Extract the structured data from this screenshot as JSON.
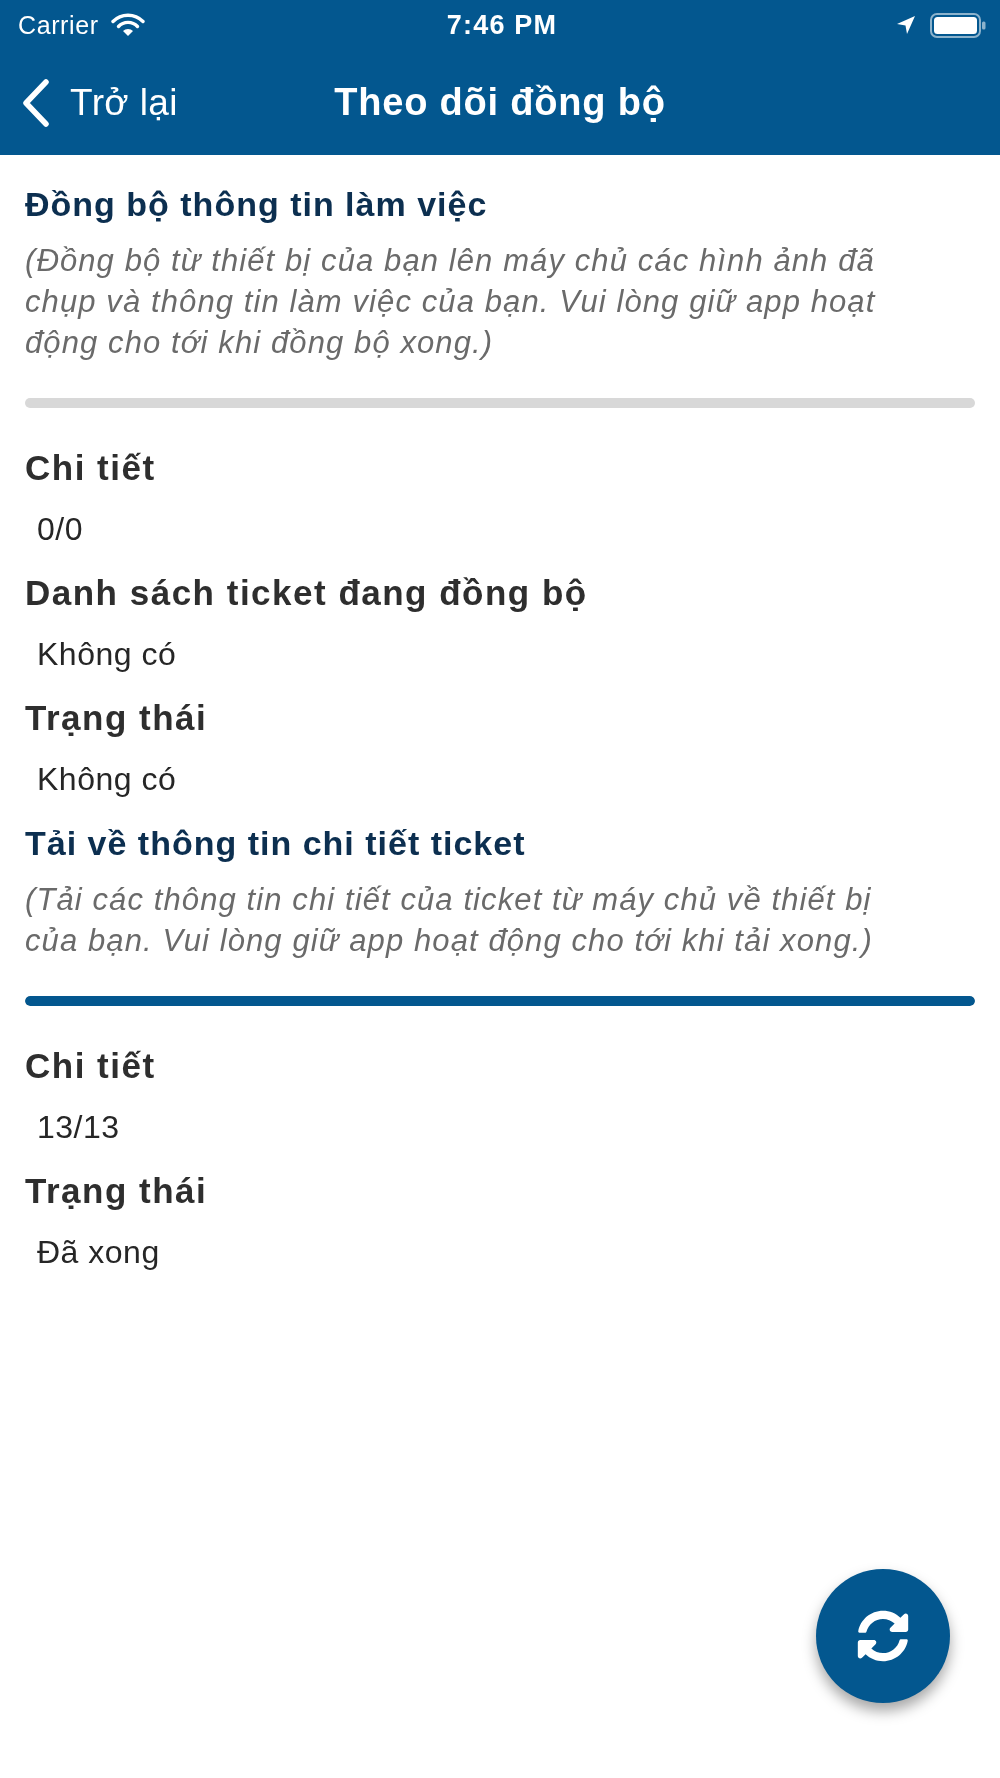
{
  "status_bar": {
    "carrier": "Carrier",
    "time": "7:46 PM"
  },
  "nav_bar": {
    "back": "Trở lại",
    "title": "Theo dõi đồng bộ"
  },
  "sections": [
    {
      "title": "Đồng bộ thông tin làm việc",
      "description": "(Đồng bộ từ thiết bị của bạn lên máy chủ các hình ảnh đã chụp và thông tin làm việc của bạn. Vui lòng giữ app hoạt động cho tới khi đồng bộ xong.)",
      "progress": {
        "level": 0
      },
      "fields": [
        {
          "label": "Chi tiết",
          "value": "0/0"
        },
        {
          "label": "Danh sách ticket đang đồng bộ",
          "value": "Không có"
        },
        {
          "label": "Trạng thái",
          "value": "Không có"
        }
      ]
    },
    {
      "title": "Tải về thông tin chi tiết ticket",
      "description": "(Tải các thông tin chi tiết của ticket từ máy chủ về thiết bị của bạn. Vui lòng giữ app hoạt động cho tới khi tải xong.)",
      "progress": {
        "level": 1
      },
      "fields": [
        {
          "label": "Chi tiết",
          "value": "13/13"
        },
        {
          "label": "Trạng thái",
          "value": "Đã xong"
        }
      ]
    }
  ]
}
